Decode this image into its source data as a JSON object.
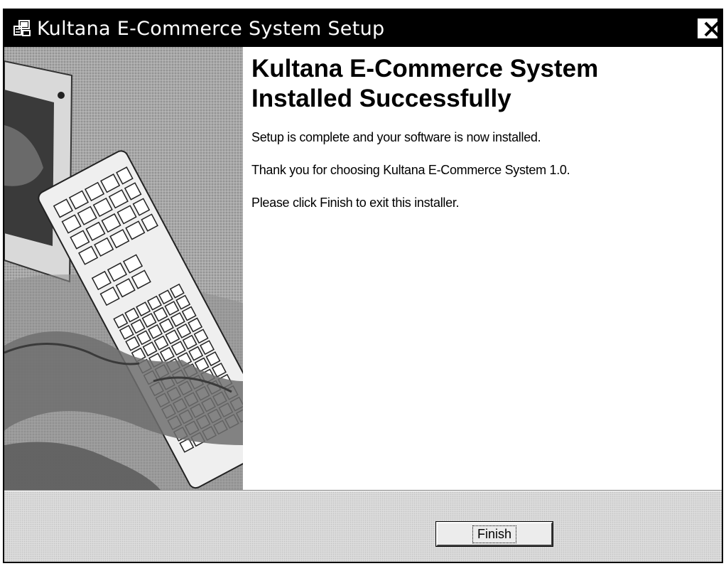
{
  "window": {
    "title": "Kultana E-Commerce System Setup",
    "close_icon": "close-icon",
    "installer_icon": "installer-icon"
  },
  "content": {
    "heading_line1": "Kultana E-Commerce System",
    "heading_line2": "Installed Successfully",
    "paragraphs": [
      "Setup is complete and your software is now installed.",
      "Thank you for choosing Kultana E-Commerce System 1.0.",
      "Please click Finish to exit this installer."
    ]
  },
  "buttons": {
    "finish_label": "Finish"
  },
  "colors": {
    "title_bar": "#000000",
    "window_background": "#ffffff",
    "footer_background": "#dcdcdc"
  }
}
